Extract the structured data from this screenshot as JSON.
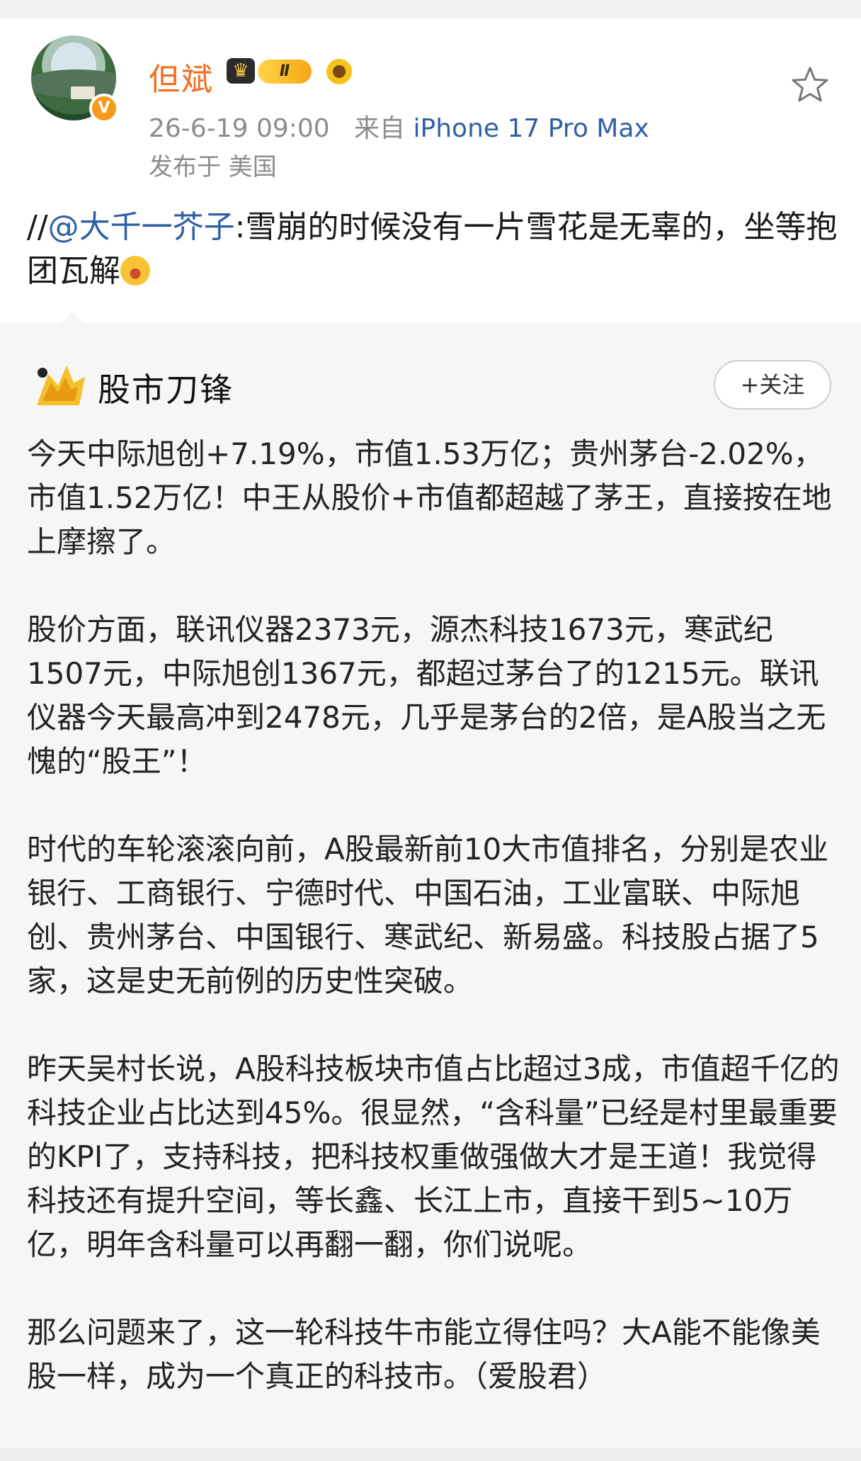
{
  "post": {
    "username": "但斌",
    "crown_badge": "♛",
    "level_badge": "Ⅱ",
    "timestamp": "26-6-19 09:00",
    "source_prefix": "来自",
    "device": "iPhone 17 Pro Max",
    "location": "发布于 美国",
    "text_prefix": "//",
    "mention": "@大千一芥子",
    "text_body": ":雪崩的时候没有一片雪花是无辜的，坐等抱团瓦解",
    "verified_mark": "V"
  },
  "repost": {
    "source_name": "股市刀锋",
    "follow_label": "+关注",
    "paragraphs": [
      "今天中际旭创+7.19%，市值1.53万亿；贵州茅台-2.02%，市值1.52万亿！中王从股价+市值都超越了茅王，直接按在地上摩擦了。",
      "股价方面，联讯仪器2373元，源杰科技1673元，寒武纪1507元，中际旭创1367元，都超过茅台了的1215元。联讯仪器今天最高冲到2478元，几乎是茅台的2倍，是A股当之无愧的“股王”！",
      "时代的车轮滚滚向前，A股最新前10大市值排名，分别是农业银行、工商银行、宁德时代、中国石油，工业富联、中际旭创、贵州茅台、中国银行、寒武纪、新易盛。科技股占据了5家，这是史无前例的历史性突破。",
      "昨天吴村长说，A股科技板块市值占比超过3成，市值超千亿的科技企业占比达到45%。很显然，“含科量”已经是村里最重要的KPI了，支持科技，把科技权重做强做大才是王道！我觉得科技还有提升空间，等长鑫、长江上市，直接干到5~10万亿，明年含科量可以再翻一翻，你们说呢。",
      "那么问题来了，这一轮科技牛市能立得住吗？大A能不能像美股一样，成为一个真正的科技市。（爱股君）"
    ]
  },
  "colors": {
    "username": "#f26d1f",
    "link": "#2f5fa5",
    "meta": "#8c8c8c",
    "repost_bg": "#f6f6f6"
  },
  "icons": [
    "avatar",
    "verified-icon",
    "crown-badge-icon",
    "level-badge-icon",
    "sunflower-icon",
    "star-icon",
    "laugh-emoji-icon",
    "source-logo-icon"
  ]
}
